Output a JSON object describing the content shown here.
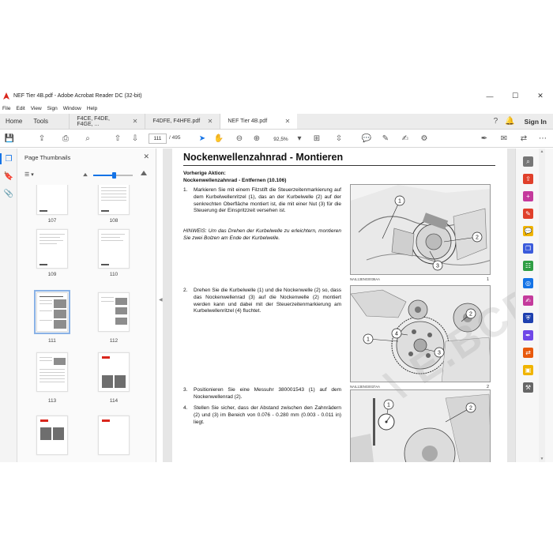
{
  "window": {
    "title": "NEF Tier 4B.pdf - Adobe Acrobat Reader DC (32-bit)",
    "controls": {
      "minimize": "—",
      "maximize": "☐",
      "close": "✕"
    }
  },
  "menu": [
    "File",
    "Edit",
    "View",
    "Sign",
    "Window",
    "Help"
  ],
  "tabs": {
    "home": "Home",
    "tools": "Tools",
    "docs": [
      {
        "label": "F4CE, F4DE, F4GE, ...",
        "close": "✕"
      },
      {
        "label": "F4DFE, F4HFE.pdf",
        "close": "✕"
      },
      {
        "label": "NEF Tier 4B.pdf",
        "close": "✕"
      }
    ],
    "sign_in": "Sign In"
  },
  "toolbar": {
    "current_page": "111",
    "total_pages": "/ 495",
    "zoom": "92,5%"
  },
  "thumbnails": {
    "title": "Page Thumbnails",
    "close": "✕",
    "pages": [
      "107",
      "108",
      "109",
      "110",
      "111",
      "112",
      "113",
      "114"
    ],
    "selected": "111"
  },
  "document": {
    "heading": "Nockenwellenzahnrad - Montieren",
    "prior_action_label": "Vorherige Aktion:",
    "prior_action_link": "Nockenwellenzahnrad - Entfernen (10.106)",
    "steps": [
      {
        "n": "1.",
        "text": "Markieren Sie mit einem Filzstift die Steuerzeitenmarkierung auf dem Kurbelwellenritzel (1), das an der Kurbelwelle (2) auf der senkrechten Oberfläche montiert ist, die mit einer Nut (3) für die Steuerung der Einspritzzeit versehen ist."
      },
      {
        "n": "2.",
        "text": "Drehen Sie die Kurbelwelle (1) und die Nockenwelle (2) so, dass das Nockenwellenrad (3) auf die Nockenwelle (2) montiert werden kann und dabei mit der Steuerzeitenmarkierung am Kurbelwellenritzel (4) fluchtet."
      },
      {
        "n": "3.",
        "text": "Positionieren Sie eine Messuhr 380001543 (1) auf dem Nockenwellenrad (2)."
      },
      {
        "n": "4.",
        "text": "Stellen Sie sicher, dass der Abstand zwischen den Zahnrädern (2) und (3) im Bereich von 0.076 - 0.280 mm (0.003 - 0.011 in) liegt."
      }
    ],
    "note": "HINWEIS: Um das Drehen der Kurbelwelle zu erleichtern, montieren Sie zwei Bolzen am Ende der Kurbelwelle.",
    "figures": [
      {
        "caption": "NAIL13ENG0036AA",
        "number": "1",
        "callouts": [
          "1",
          "2",
          "3"
        ]
      },
      {
        "caption": "NAIL13ENG0037AA",
        "number": "2",
        "callouts": [
          "1",
          "2",
          "3",
          "4"
        ]
      },
      {
        "caption": "",
        "number": "",
        "callouts": [
          "1",
          "2"
        ]
      }
    ],
    "watermark": "\\ E.BCDEPOT.COM"
  },
  "colors": {
    "accent": "#1473e6",
    "acrobat_red": "#d9261c"
  }
}
